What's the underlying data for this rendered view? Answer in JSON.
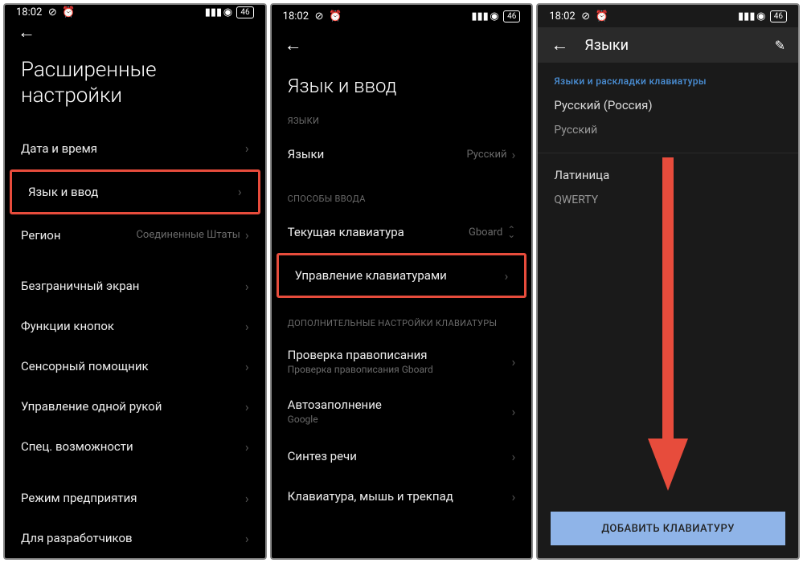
{
  "statusbar": {
    "time": "18:02",
    "battery": "46"
  },
  "screen1": {
    "title": "Расширенные настройки",
    "items": {
      "date_time": "Дата и время",
      "lang_input": "Язык и ввод",
      "region": "Регион",
      "region_val": "Соединенные Штаты",
      "borderless": "Безграничный экран",
      "buttons": "Функции кнопок",
      "assistant": "Сенсорный помощник",
      "onehand": "Управление одной рукой",
      "accessibility": "Спец. возможности",
      "enterprise": "Режим предприятия",
      "developer": "Для разработчиков"
    }
  },
  "screen2": {
    "title": "Язык и ввод",
    "sec_lang": "ЯЗЫКИ",
    "lang_label": "Языки",
    "lang_val": "Русский",
    "sec_input": "СПОСОБЫ ВВОДА",
    "current_kb": "Текущая клавиатура",
    "current_kb_val": "Gboard",
    "manage_kb": "Управление клавиатурами",
    "sec_extra": "ДОПОЛНИТЕЛЬНЫЕ НАСТРОЙКИ КЛАВИАТУРЫ",
    "spellcheck": "Проверка правописания",
    "spellcheck_sub": "Проверка правописания Gboard",
    "autofill": "Автозаполнение",
    "autofill_sub": "Google",
    "tts": "Синтез речи",
    "kbm": "Клавиатура, мышь и трекпад"
  },
  "screen3": {
    "title": "Языки",
    "section": "Языки и раскладки клавиатуры",
    "lang1": "Русский (Россия)",
    "lang1_sub": "Русский",
    "lang2": "Латиница",
    "lang2_sub": "QWERTY",
    "add_btn": "ДОБАВИТЬ КЛАВИАТУРУ"
  }
}
